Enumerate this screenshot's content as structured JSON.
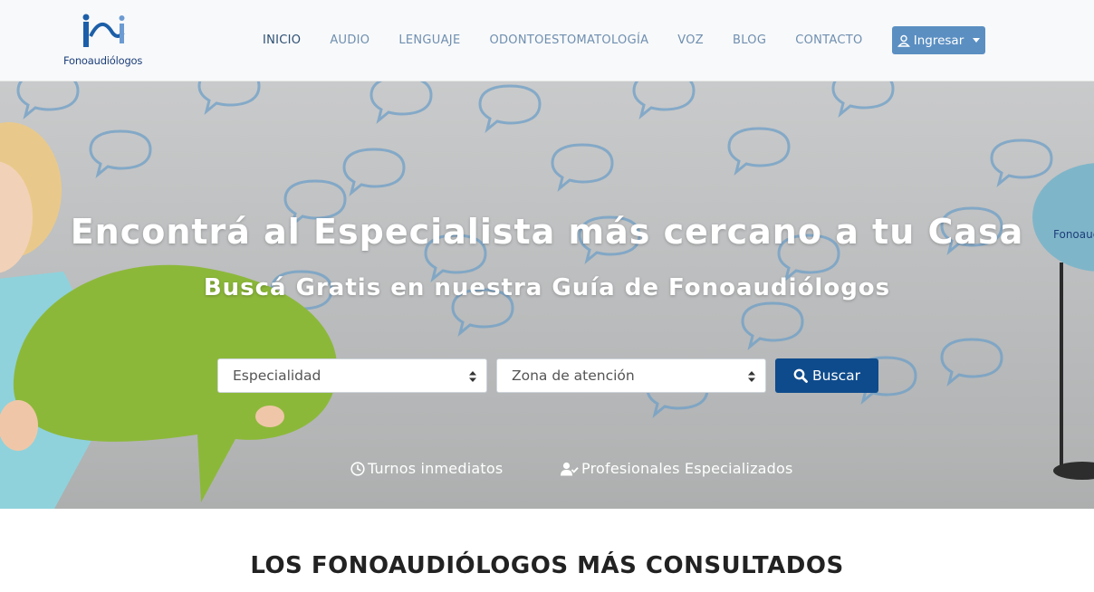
{
  "brand": {
    "logo_text": "Fonoaudiólogos"
  },
  "nav": {
    "items": [
      {
        "label": "INICIO",
        "active": true
      },
      {
        "label": "AUDIO",
        "active": false
      },
      {
        "label": "LENGUAJE",
        "active": false
      },
      {
        "label": "ODONTOESTOMATOLOGÍA",
        "active": false
      },
      {
        "label": "VOZ",
        "active": false
      },
      {
        "label": "BLOG",
        "active": false
      },
      {
        "label": "CONTACTO",
        "active": false
      }
    ],
    "login_label": "Ingresar"
  },
  "hero": {
    "title": "Encontrá al Especialista más cercano a tu Casa",
    "subtitle": "Buscá Gratis en nuestra Guía de Fonoaudiólogos",
    "sign_text": "Fonoaud",
    "specialty_select": {
      "value": "Especialidad"
    },
    "zone_select": {
      "value": "Zona de atención"
    },
    "search_label": "Buscar",
    "features": [
      {
        "icon": "clock-icon",
        "label": "Turnos inmediatos"
      },
      {
        "icon": "user-check-icon",
        "label": "Profesionales Especializados"
      }
    ]
  },
  "section": {
    "title": "LOS FONOAUDIÓLOGOS MÁS CONSULTADOS"
  },
  "colors": {
    "nav_link": "#6f8fb0",
    "nav_active": "#2d4f73",
    "login_button": "#5b8fc2",
    "search_button": "#0e4b8c",
    "bubble_green": "#8cb83a"
  }
}
